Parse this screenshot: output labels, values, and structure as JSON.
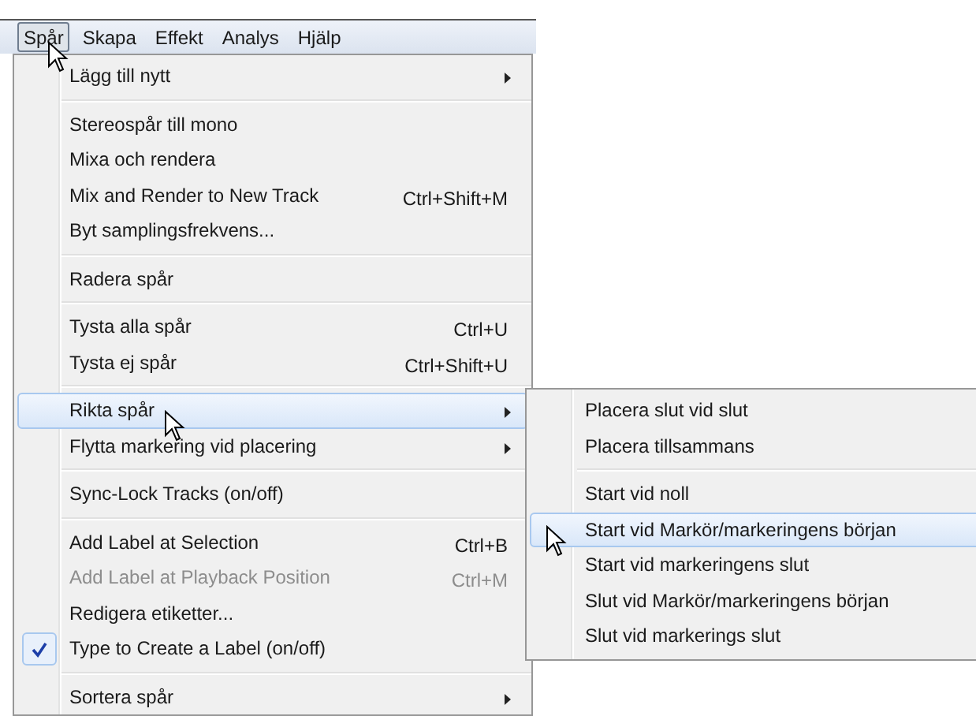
{
  "menu_bar": [
    {
      "label": "Spår",
      "selected": true
    },
    {
      "label": "Skapa",
      "selected": false
    },
    {
      "label": "Effekt",
      "selected": false
    },
    {
      "label": "Analys",
      "selected": false
    },
    {
      "label": "Hjälp",
      "selected": false
    }
  ],
  "menu": [
    {
      "kind": "item",
      "label": "Lägg till nytt",
      "submenu": true,
      "selected": false,
      "disabled": false,
      "checked": false
    },
    {
      "kind": "separator"
    },
    {
      "kind": "item",
      "label": "Stereospår till mono",
      "submenu": false,
      "selected": false,
      "disabled": false,
      "checked": false
    },
    {
      "kind": "item",
      "label": "Mixa och rendera",
      "submenu": false,
      "selected": false,
      "disabled": false,
      "checked": false
    },
    {
      "kind": "item",
      "label": "Mix and Render to New Track",
      "shortcut": "Ctrl+Shift+M",
      "submenu": false,
      "selected": false,
      "disabled": false,
      "checked": false
    },
    {
      "kind": "item",
      "label": "Byt samplingsfrekvens...",
      "submenu": false,
      "selected": false,
      "disabled": false,
      "checked": false
    },
    {
      "kind": "separator"
    },
    {
      "kind": "item",
      "label": "Radera spår",
      "submenu": false,
      "selected": false,
      "disabled": false,
      "checked": false
    },
    {
      "kind": "separator"
    },
    {
      "kind": "item",
      "label": "Tysta alla spår",
      "shortcut": "Ctrl+U",
      "submenu": false,
      "selected": false,
      "disabled": false,
      "checked": false
    },
    {
      "kind": "item",
      "label": "Tysta ej spår",
      "shortcut": "Ctrl+Shift+U",
      "submenu": false,
      "selected": false,
      "disabled": false,
      "checked": false
    },
    {
      "kind": "separator"
    },
    {
      "kind": "item",
      "label": "Rikta spår",
      "submenu": true,
      "selected": true,
      "disabled": false,
      "checked": false
    },
    {
      "kind": "item",
      "label": "Flytta markering vid placering",
      "submenu": true,
      "selected": false,
      "disabled": false,
      "checked": false
    },
    {
      "kind": "separator"
    },
    {
      "kind": "item",
      "label": "Sync-Lock Tracks (on/off)",
      "submenu": false,
      "selected": false,
      "disabled": false,
      "checked": false
    },
    {
      "kind": "separator"
    },
    {
      "kind": "item",
      "label": "Add Label at Selection",
      "shortcut": "Ctrl+B",
      "submenu": false,
      "selected": false,
      "disabled": false,
      "checked": false
    },
    {
      "kind": "item",
      "label": "Add Label at Playback Position",
      "shortcut": "Ctrl+M",
      "submenu": false,
      "selected": false,
      "disabled": true,
      "checked": false
    },
    {
      "kind": "item",
      "label": "Redigera etiketter...",
      "submenu": false,
      "selected": false,
      "disabled": false,
      "checked": false
    },
    {
      "kind": "item",
      "label": "Type to Create a Label (on/off)",
      "submenu": false,
      "selected": false,
      "disabled": false,
      "checked": true
    },
    {
      "kind": "separator"
    },
    {
      "kind": "item",
      "label": "Sortera spår",
      "submenu": true,
      "selected": false,
      "disabled": false,
      "checked": false
    }
  ],
  "submenu": [
    {
      "kind": "item",
      "label": "Placera slut vid slut",
      "selected": false
    },
    {
      "kind": "item",
      "label": "Placera tillsammans",
      "selected": false
    },
    {
      "kind": "separator"
    },
    {
      "kind": "item",
      "label": "Start vid noll",
      "selected": false
    },
    {
      "kind": "item",
      "label": "Start vid Markör/markeringens början",
      "selected": true
    },
    {
      "kind": "item",
      "label": "Start vid markeringens slut",
      "selected": false
    },
    {
      "kind": "item",
      "label": "Slut vid Markör/markeringens början",
      "selected": false
    },
    {
      "kind": "item",
      "label": "Slut vid markerings slut",
      "selected": false
    }
  ]
}
